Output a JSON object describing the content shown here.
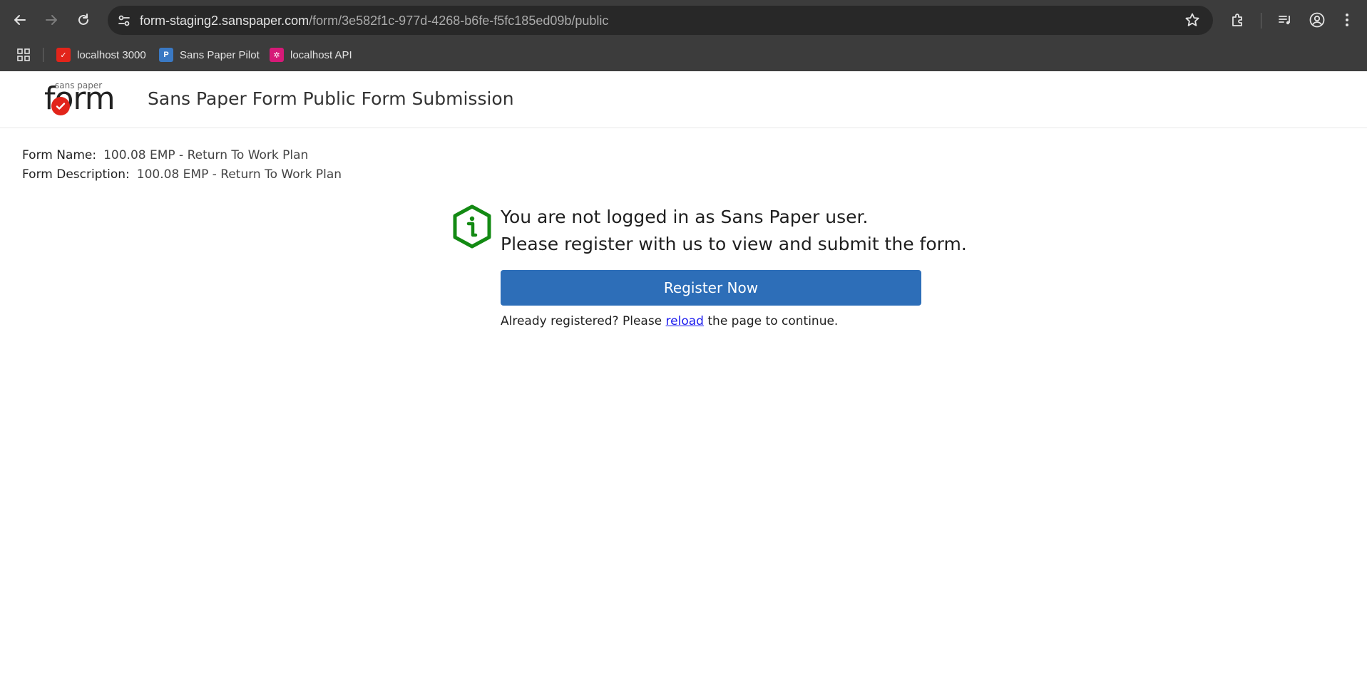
{
  "browser": {
    "url_host": "form-staging2.sanspaper.com",
    "url_path": "/form/3e582f1c-977d-4268-b6fe-f5fc185ed09b/public",
    "bookmarks": [
      {
        "label": "localhost 3000",
        "icon": "sanspaper-red-icon",
        "color": "#e2241a"
      },
      {
        "label": "Sans Paper Pilot",
        "icon": "pilot-p-icon",
        "color": "#3a79c4"
      },
      {
        "label": "localhost API",
        "icon": "api-gear-icon",
        "color": "#d61a78"
      }
    ]
  },
  "header": {
    "logo_small": "sans paper",
    "logo_word": "form",
    "title": "Sans Paper Form Public Form Submission"
  },
  "form": {
    "name_label": "Form Name:",
    "name_value": "100.08 EMP - Return To Work Plan",
    "description_label": "Form Description:",
    "description_value": "100.08 EMP - Return To Work Plan"
  },
  "notice": {
    "line1": "You are not logged in as Sans Paper user.",
    "line2": "Please register with us to view and submit the form.",
    "register_button": "Register Now",
    "already_prefix": "Already registered? Please ",
    "reload_link": "reload",
    "already_suffix": " the page to continue.",
    "icon_color": "#138a13",
    "button_color": "#2d6eb8"
  }
}
